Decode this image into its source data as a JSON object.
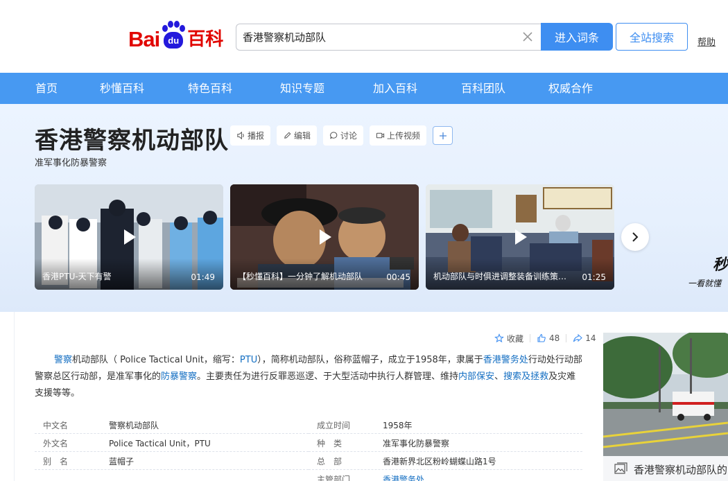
{
  "header": {
    "logo": {
      "part1": "Bai",
      "paw_text": "du",
      "part2": "百科"
    },
    "search": {
      "value": "香港警察机动部队",
      "placeholder": ""
    },
    "enter_button": "进入词条",
    "site_search_button": "全站搜索",
    "help_link": "帮助"
  },
  "nav": {
    "items": [
      "首页",
      "秒懂百科",
      "特色百科",
      "知识专题",
      "加入百科",
      "百科团队",
      "权威合作"
    ]
  },
  "hero": {
    "title": "香港警察机动部队",
    "subtitle": "准军事化防暴警察",
    "tools": [
      "播报",
      "编辑",
      "讨论",
      "上传视频"
    ],
    "videos": [
      {
        "title": "香港PTU-天下有警",
        "duration": "01:49"
      },
      {
        "title": "【秒懂百科】一分钟了解机动部队",
        "duration": "00:45"
      },
      {
        "title": "机动部队与时俱进调整装备训练策略...",
        "duration": "01:25"
      }
    ],
    "promo_text": "秒",
    "promo_sub": "一看就懂"
  },
  "actions": {
    "favorite": "收藏",
    "like_count": "48",
    "share_count": "14"
  },
  "summary": {
    "s1": "警察",
    "s2": "机动部队（ Police Tactical Unit，缩写：",
    "s3": "PTU",
    "s4": "），简称机动部队，俗称蓝帽子，成立于1958年，隶属于",
    "s5": "香港警务处",
    "s6": "行动处行动部警察总区行动部，是准军事化的",
    "s7": "防暴警察",
    "s8": "。主要责任为进行反罪恶巡逻、于大型活动中执行人群管理、维持",
    "s9": "内部保安",
    "s10": "、",
    "s11": "搜索及拯救",
    "s12": "及灾难支援等等。"
  },
  "basic_info": {
    "left": [
      {
        "key": "中文名",
        "value": "警察机动部队"
      },
      {
        "key": "外文名",
        "value": "Police Tactical Unit，PTU"
      },
      {
        "key": "别　名",
        "value": "蓝帽子"
      }
    ],
    "right": [
      {
        "key": "成立时间",
        "value": "1958年"
      },
      {
        "key": "种　类",
        "value": "准军事化防暴警察"
      },
      {
        "key": "总　部",
        "value": "香港新界北区粉岭蝴蝶山路1号"
      },
      {
        "key": "主管部门",
        "value": "香港警务处"
      }
    ]
  },
  "album": {
    "caption": "香港警察机动部队的"
  },
  "colors": {
    "brand_red": "#e10601",
    "brand_blue": "#2319dc",
    "nav_blue": "#4799f2",
    "button_blue": "#3e8ef1",
    "link_blue": "#136ec2"
  }
}
